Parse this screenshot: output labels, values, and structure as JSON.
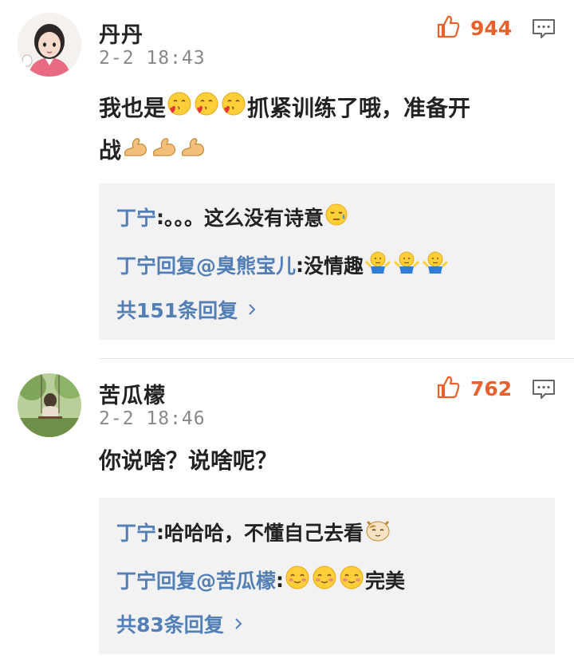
{
  "comments": [
    {
      "username": "丹丹",
      "timestamp": "2-2 18:43",
      "likes": "944",
      "content_part1": "我也是",
      "content_part2": "抓紧训练了哦，准备开",
      "content_part3": "战",
      "replies": [
        {
          "author": "丁宁",
          "separator": ": ",
          "text": "。。。这么没有诗意"
        },
        {
          "author": "丁宁",
          "verb": "回复",
          "mention": "@臭熊宝儿",
          "separator": ":",
          "text": "没情趣"
        }
      ],
      "more_replies": "共151条回复"
    },
    {
      "username": "苦瓜檬",
      "timestamp": "2-2 18:46",
      "likes": "762",
      "content_part1": "你说啥？说啥呢？",
      "replies": [
        {
          "author": "丁宁",
          "separator": ": ",
          "text": "哈哈哈，不懂自己去看"
        },
        {
          "author": "丁宁",
          "verb": "回复",
          "mention": "@苦瓜檬",
          "separator": ":",
          "text": "完美"
        }
      ],
      "more_replies": "共83条回复"
    }
  ],
  "colors": {
    "link": "#527fb5",
    "like": "#e8612c"
  },
  "icons": {
    "like": "thumbs-up-icon",
    "reply": "comment-bubble-icon",
    "more": "chevron-right-icon"
  }
}
